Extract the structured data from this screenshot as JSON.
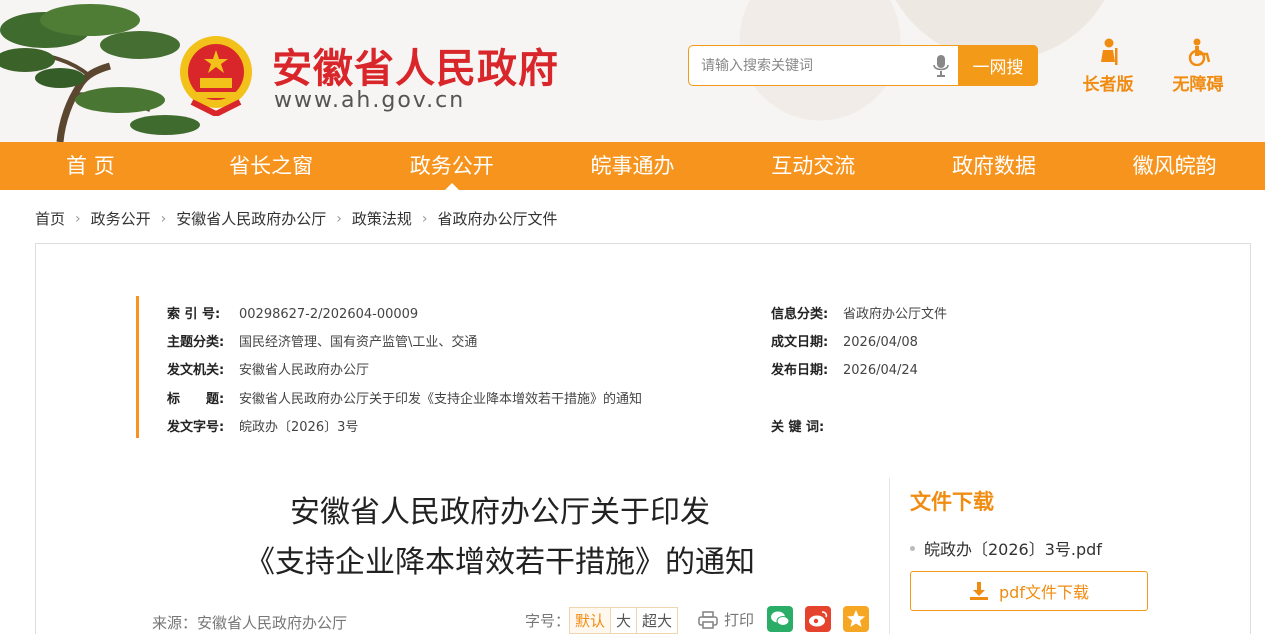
{
  "header": {
    "site_name": "安徽省人民政府",
    "site_url": "www.ah.gov.cn",
    "search_placeholder": "请输入搜索关键词",
    "search_button": "一网搜",
    "elder_mode": "长者版",
    "accessibility": "无障碍"
  },
  "nav": {
    "items": [
      "首 页",
      "省长之窗",
      "政务公开",
      "皖事通办",
      "互动交流",
      "政府数据",
      "徽风皖韵"
    ],
    "active": "政务公开"
  },
  "breadcrumb": [
    "首页",
    "政务公开",
    "安徽省人民政府办公厅",
    "政策法规",
    "省政府办公厅文件"
  ],
  "meta": {
    "index_no": {
      "label": "索 引 号:",
      "value": "00298627-2/202604-00009"
    },
    "topic": {
      "label": "主题分类:",
      "value": "国民经济管理、国有资产监管\\工业、交通"
    },
    "issuer": {
      "label": "发文机关:",
      "value": "安徽省人民政府办公厅"
    },
    "title": {
      "label": "标　　题:",
      "value": "安徽省人民政府办公厅关于印发《支持企业降本增效若干措施》的通知"
    },
    "doc_no": {
      "label": "发文字号:",
      "value": "皖政办〔2026〕3号"
    },
    "category": {
      "label": "信息分类:",
      "value": "省政府办公厅文件"
    },
    "written_date": {
      "label": "成文日期:",
      "value": "2026/04/08"
    },
    "publish_date": {
      "label": "发布日期:",
      "value": "2026/04/24"
    },
    "keywords": {
      "label": "关 键 词:",
      "value": ""
    }
  },
  "document": {
    "title_line1": "安徽省人民政府办公厅关于印发",
    "title_line2": "《支持企业降本增效若干措施》的通知",
    "source": "来源：安徽省人民政府办公厅",
    "font_size_label": "字号：",
    "font_sizes": [
      "默认",
      "大",
      "超大"
    ],
    "font_size_active": "默认",
    "print_label": "打印"
  },
  "download": {
    "title": "文件下载",
    "file_name": "皖政办〔2026〕3号.pdf",
    "button_label": "pdf文件下载"
  },
  "colors": {
    "brand_orange": "#f7941d",
    "title_red": "#d9262a"
  },
  "icons": [
    "pine-tree-icon",
    "national-emblem-icon",
    "microphone-icon",
    "elder-icon",
    "wheelchair-icon",
    "print-icon",
    "wechat-icon",
    "weibo-icon",
    "favorite-icon",
    "download-icon"
  ]
}
